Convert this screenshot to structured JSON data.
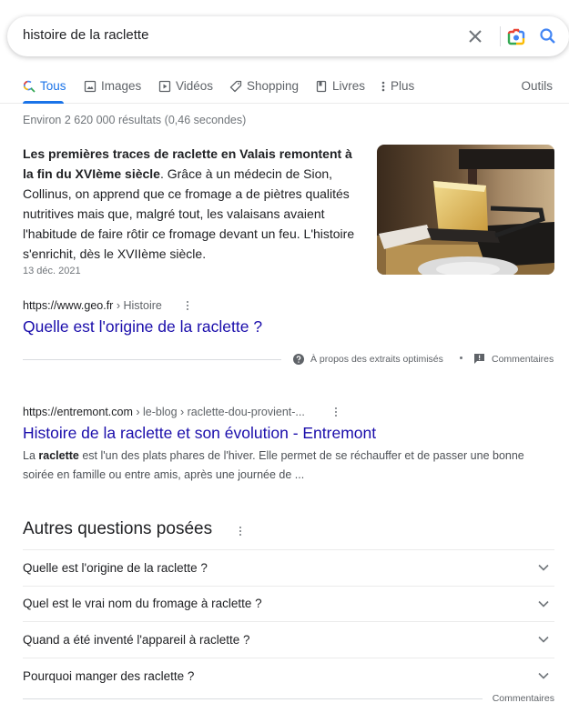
{
  "search": {
    "query": "histoire de la raclette",
    "clear_icon": "close-icon",
    "lens_icon": "google-lens-icon",
    "search_icon": "search-icon"
  },
  "tabs": [
    {
      "label": "Tous",
      "icon": "search-icon",
      "active": true
    },
    {
      "label": "Images",
      "icon": "image-icon",
      "active": false
    },
    {
      "label": "Vidéos",
      "icon": "play-icon",
      "active": false
    },
    {
      "label": "Shopping",
      "icon": "tag-icon",
      "active": false
    },
    {
      "label": "Livres",
      "icon": "book-icon",
      "active": false
    },
    {
      "label": "Plus",
      "icon": "more-vert-icon",
      "active": false
    }
  ],
  "tools_label": "Outils",
  "stats": "Environ 2 620 000 résultats (0,46 secondes)",
  "featured_snippet": {
    "bold_text": "Les premières traces de raclette en Valais remontent à la fin du XVIème siècle",
    "text": ". Grâce à un médecin de Sion, Collinus, on apprend que ce fromage a de piètres qualités nutritives mais que, malgré tout, les valaisans avaient l'habitude de faire rôtir ce fromage devant un feu. L'histoire s'enrichit, dès le XVIIème siècle.",
    "date": "13 déc. 2021",
    "image_alt": "Raclette cheese on a raclette machine",
    "source": {
      "domain": "https://www.geo.fr",
      "path": " › Histoire",
      "title": "Quelle est l'origine de la raclette ?"
    },
    "about_label": "À propos des extraits optimisés",
    "feedback_label": "Commentaires"
  },
  "results": [
    {
      "domain": "https://entremont.com",
      "path": " › le-blog › raclette-dou-provient-...",
      "title": "Histoire de la raclette et son évolution - Entremont",
      "desc_prefix": "La ",
      "desc_bold": "raclette",
      "desc": " est l'un des plats phares de l'hiver. Elle permet de se réchauffer et de passer une bonne soirée en famille ou entre amis, après une journée de ..."
    }
  ],
  "paa": {
    "title": "Autres questions posées",
    "questions": [
      "Quelle est l'origine de la raclette ?",
      "Quel est le vrai nom du fromage à raclette ?",
      "Quand a été inventé l'appareil à raclette ?",
      "Pourquoi manger des raclette ?"
    ],
    "feedback_label": "Commentaires"
  },
  "colors": {
    "link": "#1a0dab",
    "accent": "#1a73e8",
    "text": "#202124",
    "muted": "#70757a"
  }
}
